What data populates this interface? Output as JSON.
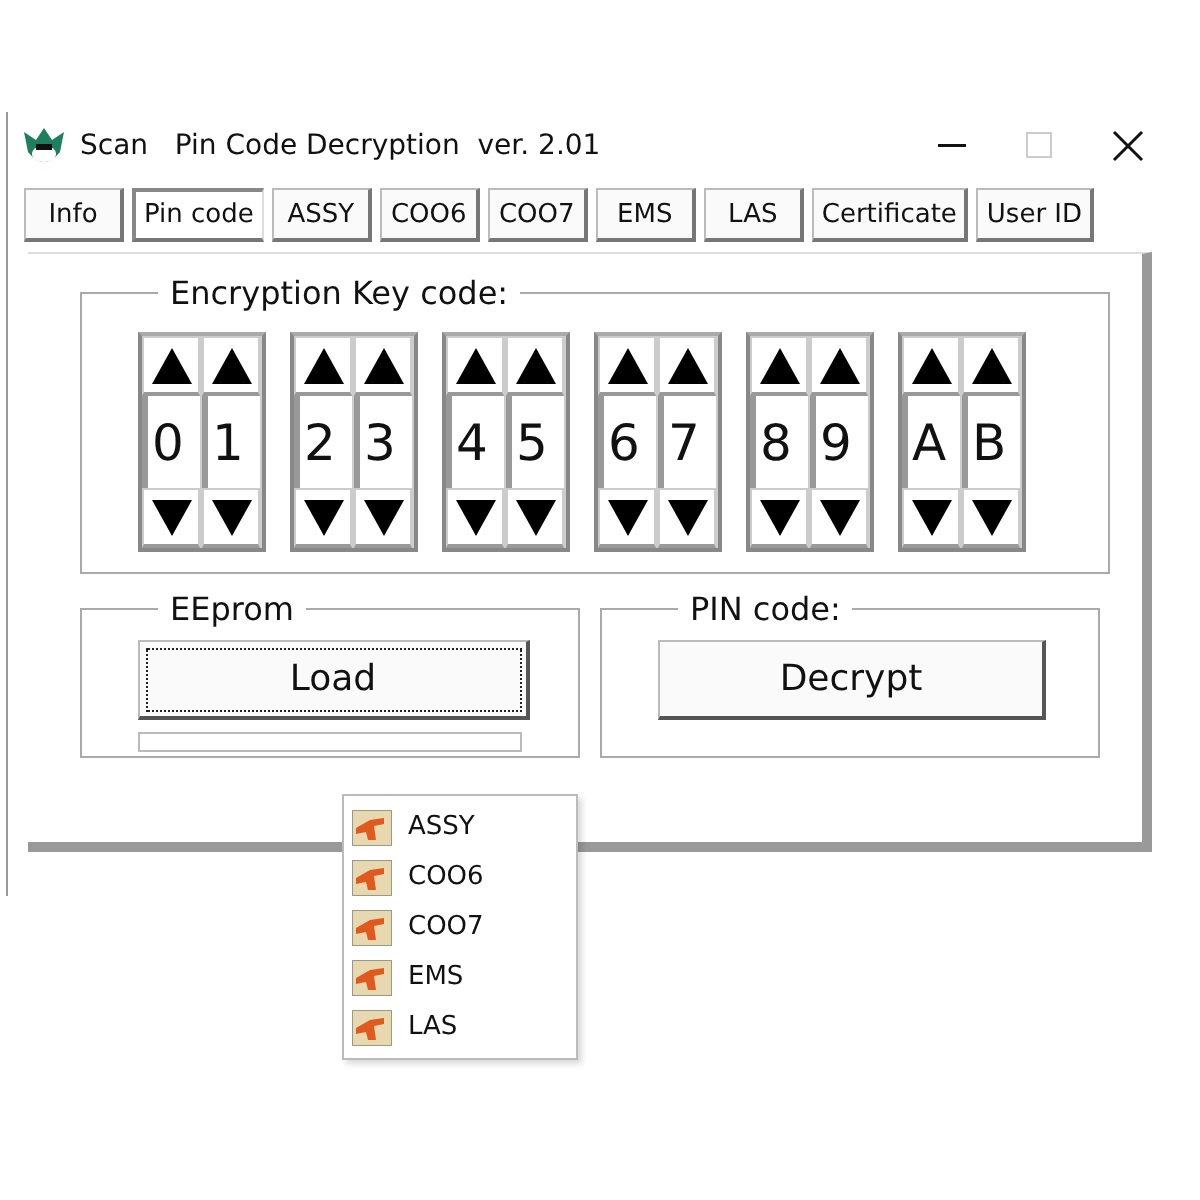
{
  "window": {
    "title": "Scan   Pin Code Decryption  ver. 2.01",
    "maximize_disabled": true
  },
  "tabs": [
    {
      "label": "Info",
      "selected": false
    },
    {
      "label": "Pin code",
      "selected": true
    },
    {
      "label": "ASSY",
      "selected": false
    },
    {
      "label": "COO6",
      "selected": false
    },
    {
      "label": "COO7",
      "selected": false
    },
    {
      "label": "EMS",
      "selected": false
    },
    {
      "label": "LAS",
      "selected": false
    },
    {
      "label": "Certificate",
      "selected": false
    },
    {
      "label": "User ID",
      "selected": false
    }
  ],
  "key_group": {
    "title": "Encryption Key code:",
    "bytes": [
      [
        "0",
        "1"
      ],
      [
        "2",
        "3"
      ],
      [
        "4",
        "5"
      ],
      [
        "6",
        "7"
      ],
      [
        "8",
        "9"
      ],
      [
        "A",
        "B"
      ]
    ]
  },
  "eeprom_group": {
    "title": "EEprom",
    "button": {
      "label": "Load",
      "focused": true
    }
  },
  "pin_group": {
    "title": "PIN code:",
    "button": {
      "label": "Decrypt"
    }
  },
  "load_menu": {
    "items": [
      "ASSY",
      "COO6",
      "COO7",
      "EMS",
      "LAS"
    ]
  }
}
